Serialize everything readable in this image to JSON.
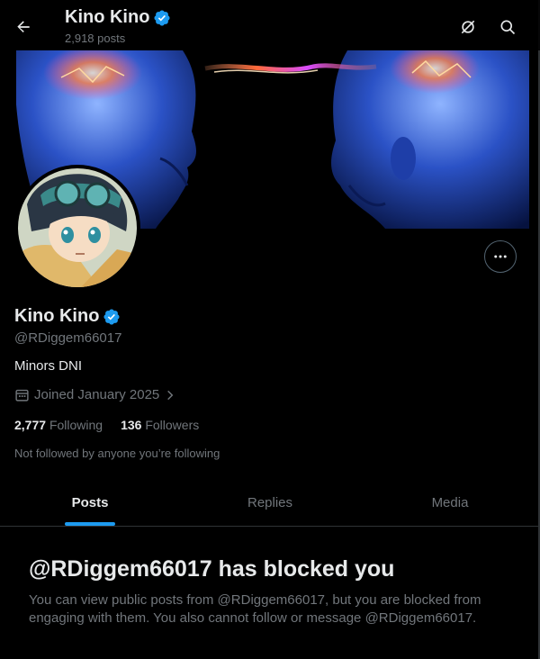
{
  "header": {
    "title": "Kino Kino",
    "post_count": "2,918 posts"
  },
  "profile": {
    "name": "Kino Kino",
    "handle": "@RDiggem66017",
    "bio": "Minors DNI",
    "joined": "Joined January 2025",
    "following_count": "2,777",
    "following_label": "Following",
    "followers_count": "136",
    "followers_label": "Followers",
    "followed_by": "Not followed by anyone you’re following"
  },
  "tabs": [
    {
      "label": "Posts",
      "active": true
    },
    {
      "label": "Replies",
      "active": false
    },
    {
      "label": "Media",
      "active": false
    }
  ],
  "blocked": {
    "title": "@RDiggem66017 has blocked you",
    "text": "You can view public posts from @RDiggem66017, but you are blocked from engaging with them. You also cannot follow or message @RDiggem66017."
  },
  "colors": {
    "accent": "#1d9bf0",
    "muted": "#71767b",
    "text": "#e7e9ea",
    "background": "#000000",
    "verified": "#1d9bf0"
  },
  "icons": {
    "back": "arrow-left-icon",
    "sync": "sync-icon",
    "search": "search-icon",
    "verified": "verified-badge-icon",
    "calendar": "calendar-icon",
    "chevron": "chevron-right-icon",
    "more": "more-icon"
  }
}
